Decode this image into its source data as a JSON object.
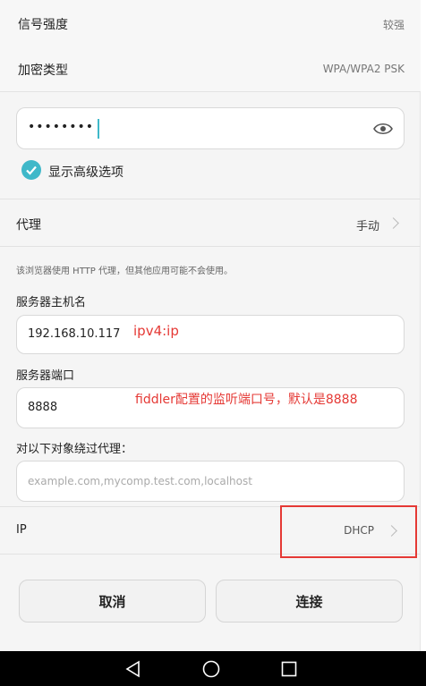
{
  "signal": {
    "label": "信号强度",
    "value": "较强"
  },
  "encryption": {
    "label": "加密类型",
    "value": "WPA/WPA2 PSK"
  },
  "password": {
    "value": "••••••••",
    "icon": "eye-icon"
  },
  "advanced": {
    "label": "显示高级选项",
    "checked": true
  },
  "proxy": {
    "label": "代理",
    "value": "手动"
  },
  "proxy_note": "该浏览器使用 HTTP 代理，但其他应用可能不会使用。",
  "hostname": {
    "label": "服务器主机名",
    "value": "192.168.10.117",
    "annotation": "ipv4:ip"
  },
  "port": {
    "label": "服务器端口",
    "value": "8888",
    "annotation": "fiddler配置的监听端口号，默认是8888"
  },
  "bypass": {
    "label": "对以下对象绕过代理：",
    "placeholder": "example.com,mycomp.test.com,localhost"
  },
  "ip": {
    "label": "IP",
    "value": "DHCP"
  },
  "buttons": {
    "cancel": "取消",
    "connect": "连接"
  },
  "colors": {
    "accent": "#3fb8c9",
    "annotation": "#e53935"
  }
}
